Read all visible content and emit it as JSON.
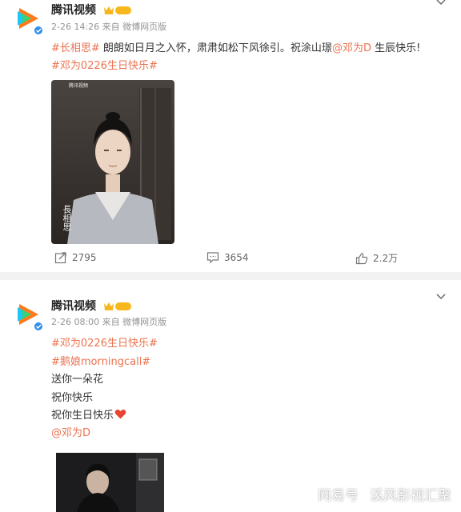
{
  "colors": {
    "link": "#eb7350",
    "meta": "#939393",
    "heart": "#e8442f"
  },
  "posts": [
    {
      "name": "腾讯视频",
      "badge": "1",
      "time_source": "2-26 14:26 来自 微博网页版",
      "lines": [
        {
          "tag": "#长相思#",
          "text": " 朗朗如日月之入怀，肃肃如松下风徐引。祝涂山璟",
          "mention": "@邓为D",
          "tail": " 生辰快乐!"
        },
        {
          "tag": "#邓为0226生日快乐#"
        }
      ],
      "image": {
        "corner_text": "腾讯视频",
        "title_chars": "長相思"
      },
      "actions": {
        "share": "2795",
        "comment": "3654",
        "like": "2.2万"
      }
    },
    {
      "name": "腾讯视频",
      "badge": "1",
      "time_source": "2-26 08:00 来自 微博网页版",
      "lines": [
        {
          "tag": "#邓为0226生日快乐#"
        },
        {
          "tag": "#鹅娘morningcall#"
        },
        {
          "text": "送你一朵花"
        },
        {
          "text": "祝你快乐"
        },
        {
          "text": "祝你生日快乐"
        },
        {
          "mention": "@邓为D"
        }
      ]
    }
  ],
  "watermark": {
    "left": "网易号",
    "right": "溪风影视汇聚"
  }
}
